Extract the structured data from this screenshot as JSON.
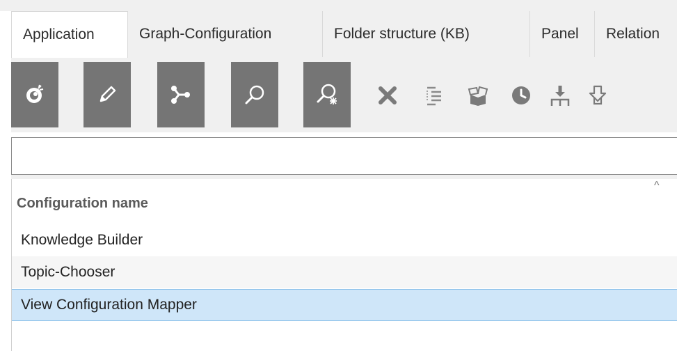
{
  "tabs": [
    {
      "label": "Application",
      "active": true
    },
    {
      "label": "Graph-Configuration",
      "active": false
    },
    {
      "label": "Folder structure (KB)",
      "active": false
    },
    {
      "label": "Panel",
      "active": false
    },
    {
      "label": "Relation",
      "active": false
    }
  ],
  "toolbar": {
    "buttons": [
      {
        "icon": "new-bomb-icon"
      },
      {
        "icon": "pencil-icon"
      },
      {
        "icon": "graph-nodes-icon"
      },
      {
        "icon": "search-icon"
      },
      {
        "icon": "search-sparkle-icon"
      },
      {
        "icon": "delete-x-icon"
      },
      {
        "icon": "indent-list-icon"
      },
      {
        "icon": "open-box-icon"
      },
      {
        "icon": "clock-icon"
      },
      {
        "icon": "merge-down-icon"
      },
      {
        "icon": "export-arrow-icon"
      }
    ],
    "dark_button_color": "#757575",
    "light_icon_color": "#7a7a7a"
  },
  "search": {
    "value": "",
    "placeholder": ""
  },
  "list": {
    "column_header": "Configuration name",
    "sort_indicator": "^",
    "rows": [
      {
        "label": "Knowledge Builder",
        "selected": false
      },
      {
        "label": "Topic-Chooser",
        "selected": false
      },
      {
        "label": "View Configuration Mapper",
        "selected": true
      }
    ],
    "selected_color": "#cfe6f9"
  }
}
